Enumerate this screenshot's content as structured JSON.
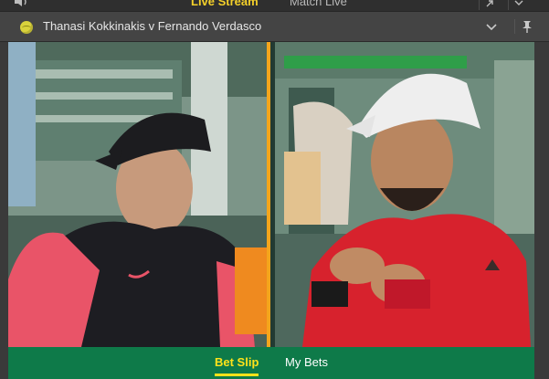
{
  "top_tabs": {
    "live_stream": "Live Stream",
    "match_live": "Match Live"
  },
  "event": {
    "title": "Thanasi Kokkinakis v Fernando Verdasco"
  },
  "bottom_tabs": {
    "bet_slip": "Bet Slip",
    "my_bets": "My Bets"
  },
  "colors": {
    "accent_yellow": "#ffe21a",
    "bottom_bar_green": "#0e7a49",
    "header_grey": "#444444",
    "divider_orange": "#f4a51c"
  },
  "icons": {
    "volume": "volume-icon",
    "tennis_ball": "tennis-ball-icon",
    "collapse": "chevron-down-icon",
    "pin": "pin-icon",
    "popout": "popout-icon"
  }
}
